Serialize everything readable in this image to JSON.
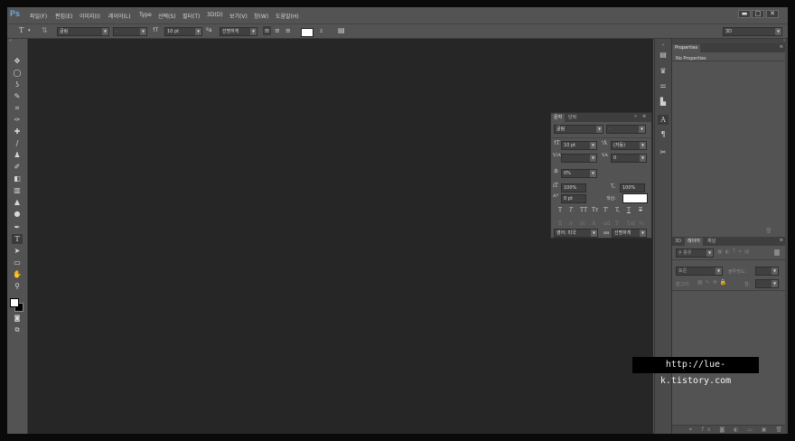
{
  "app": {
    "logo": "Ps"
  },
  "menu": [
    "파일(F)",
    "편집(E)",
    "이미지(I)",
    "레이어(L)",
    "Type",
    "선택(S)",
    "필터(T)",
    "3D(D)",
    "보기(V)",
    "창(W)",
    "도움말(H)"
  ],
  "window_controls": {
    "minimize": "▬",
    "maximize": "□",
    "close": "✕"
  },
  "options_bar": {
    "font_family": "굴림",
    "font_style": "-",
    "font_size": "10 pt",
    "antialias": "선명하게",
    "workspace": "3D"
  },
  "toolbox": {
    "tools": [
      "move-tool",
      "marquee-tool",
      "lasso-tool",
      "quick-select-tool",
      "crop-tool",
      "eyedropper-tool",
      "healing-brush-tool",
      "brush-tool",
      "clone-stamp-tool",
      "history-brush-tool",
      "eraser-tool",
      "gradient-tool",
      "blur-tool",
      "dodge-tool",
      "pen-tool",
      "type-tool",
      "path-select-tool",
      "shape-tool",
      "hand-tool",
      "zoom-tool"
    ],
    "icons": [
      "✥",
      "◯",
      "ʖ",
      "✎",
      "⌗",
      "✑",
      "✚",
      "∕",
      "♟",
      "✐",
      "◧",
      "▥",
      "▲",
      "●",
      "✒",
      "T",
      "➤",
      "▭",
      "✋",
      "⚲"
    ]
  },
  "properties_panel": {
    "tab": "Properties",
    "content": "No Properties"
  },
  "character_panel": {
    "tabs": [
      "문자",
      "단락"
    ],
    "font_family": "굴림",
    "font_style": "-",
    "font_size": "10 pt",
    "leading": "(자동)",
    "kerning": "",
    "tracking": "0",
    "tsume": "0%",
    "vertical_scale": "100%",
    "horizontal_scale": "100%",
    "baseline_shift": "0 pt",
    "color_label": "색상:",
    "style_buttons": [
      "T",
      "T",
      "TT",
      "Tт",
      "T'",
      "T,",
      "T",
      "T"
    ],
    "opentype_buttons": [
      "fi",
      "ơ",
      "st",
      "A",
      "ad",
      "T",
      "1st",
      "½"
    ],
    "language": "영어: 미국",
    "antialias_label": "aa",
    "antialias": "선명하게"
  },
  "layers_panel": {
    "tabs": [
      "3D",
      "레이어",
      "채널"
    ],
    "filter": "종류",
    "blend_mode": "표준",
    "opacity_label": "불투명도:",
    "lock_label": "잠그기:",
    "fill_label": "칠:"
  },
  "watermark": "http://lue-k.tistory.com"
}
